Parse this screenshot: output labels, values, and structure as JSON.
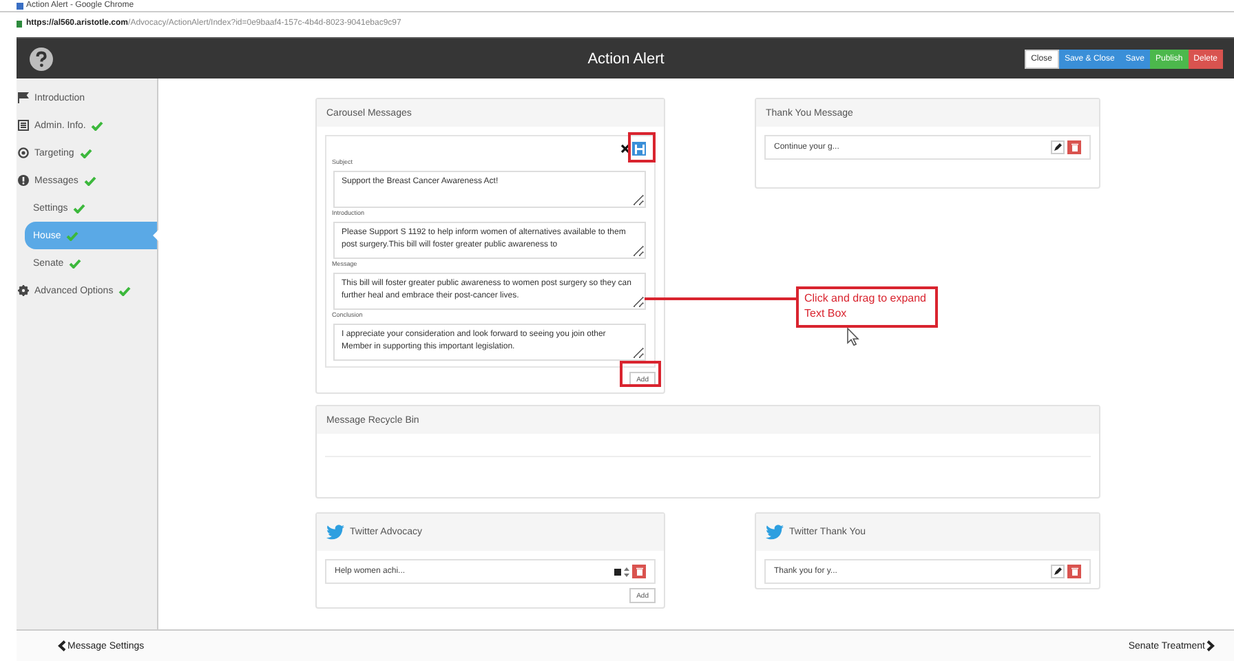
{
  "browser": {
    "title": "Action Alert - Google Chrome",
    "url_host": "https://al560.aristotle.com",
    "url_path": "/Advocacy/ActionAlert/Index?id=0e9baaf4-157c-4b4d-8023-9041ebac9c97"
  },
  "header": {
    "title": "Action Alert",
    "buttons": [
      {
        "label": "Close",
        "kind": "default"
      },
      {
        "label": "Save & Close",
        "kind": "primary"
      },
      {
        "label": "Save",
        "kind": "primary"
      },
      {
        "label": "Publish",
        "kind": "success"
      },
      {
        "label": "Delete",
        "kind": "danger"
      }
    ]
  },
  "sidebar": {
    "items": [
      {
        "label": "Introduction",
        "checked": false,
        "selected": false
      },
      {
        "label": "Admin. Info.",
        "checked": true,
        "selected": false
      },
      {
        "label": "Targeting",
        "checked": true,
        "selected": false
      },
      {
        "label": "Messages",
        "checked": true,
        "selected": false,
        "children": [
          {
            "label": "Settings",
            "checked": true,
            "selected": false
          },
          {
            "label": "House",
            "checked": true,
            "selected": true
          },
          {
            "label": "Senate",
            "checked": true,
            "selected": false
          }
        ]
      },
      {
        "label": "Advanced Options",
        "checked": true,
        "selected": false
      }
    ]
  },
  "carousel": {
    "title": "Carousel Messages",
    "fields": [
      {
        "label": "Subject",
        "value": "Support the Breast Cancer Awareness Act!"
      },
      {
        "label": "Introduction",
        "value": "Please Support S 1192 to help inform women of alternatives available to them post surgery.This bill will foster greater public awareness to"
      },
      {
        "label": "Message",
        "value": "This bill will foster greater public awareness to women post surgery so they can further heal and embrace their post-cancer lives."
      },
      {
        "label": "Conclusion",
        "value": "I appreciate your consideration and look forward to seeing you join other Member in supporting this important legislation."
      }
    ],
    "add_label": "Add"
  },
  "thank_you": {
    "title": "Thank You Message",
    "items": [
      {
        "text": "Continue your g..."
      }
    ]
  },
  "recycle_bin": {
    "title": "Message Recycle Bin"
  },
  "twitter_advocacy": {
    "title": "Twitter Advocacy",
    "items": [
      {
        "text": "Help women achi..."
      }
    ],
    "add_label": "Add"
  },
  "twitter_thanks": {
    "title": "Twitter Thank You",
    "items": [
      {
        "text": "Thank you for y..."
      }
    ]
  },
  "annotation": {
    "text": "Click and drag to expand Text Box"
  },
  "footer": {
    "previous": "Message Settings",
    "next": "Senate Treatment"
  }
}
